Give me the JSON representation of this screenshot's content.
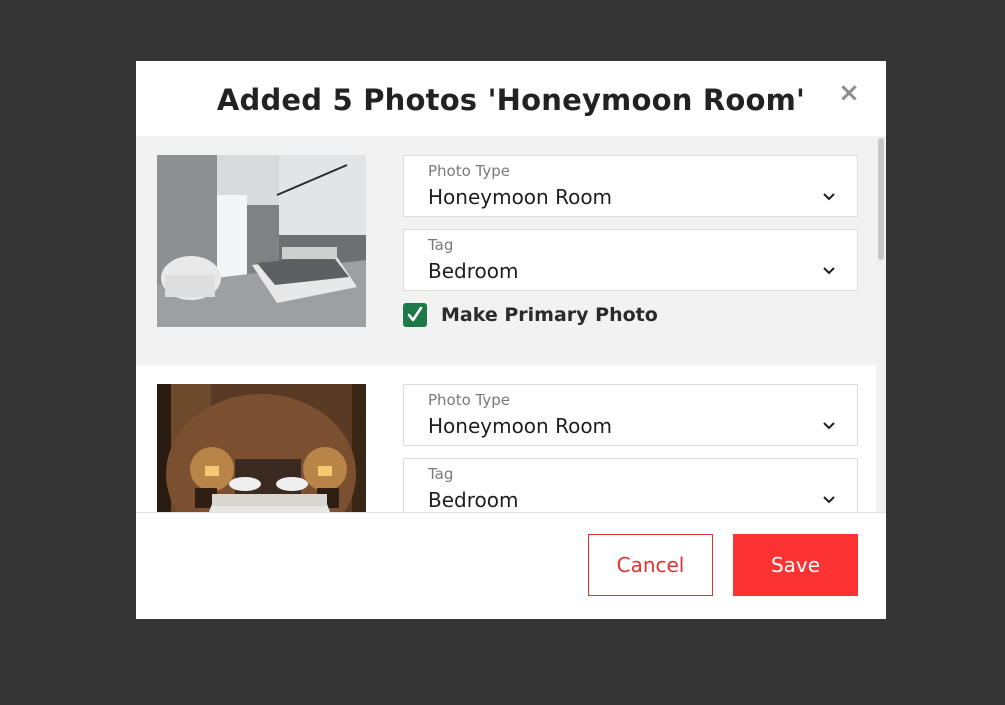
{
  "modal": {
    "title": "Added 5 Photos 'Honeymoon Room'",
    "close_glyph": "×"
  },
  "photos": [
    {
      "photo_type_label": "Photo Type",
      "photo_type_value": "Honeymoon Room",
      "tag_label": "Tag",
      "tag_value": "Bedroom",
      "primary_label": "Make Primary Photo",
      "primary_checked": true,
      "checkmark": "✓"
    },
    {
      "photo_type_label": "Photo Type",
      "photo_type_value": "Honeymoon Room",
      "tag_label": "Tag",
      "tag_value": "Bedroom"
    }
  ],
  "footer": {
    "cancel_label": "Cancel",
    "save_label": "Save"
  },
  "colors": {
    "overlay": "#353535",
    "accent_red": "#fd3232",
    "checkbox_green": "#1d7a46",
    "row_highlight": "#f2f2f2"
  },
  "icons": {
    "close": "close-icon",
    "dropdown": "chevron-down-icon",
    "check": "checkmark-icon"
  }
}
